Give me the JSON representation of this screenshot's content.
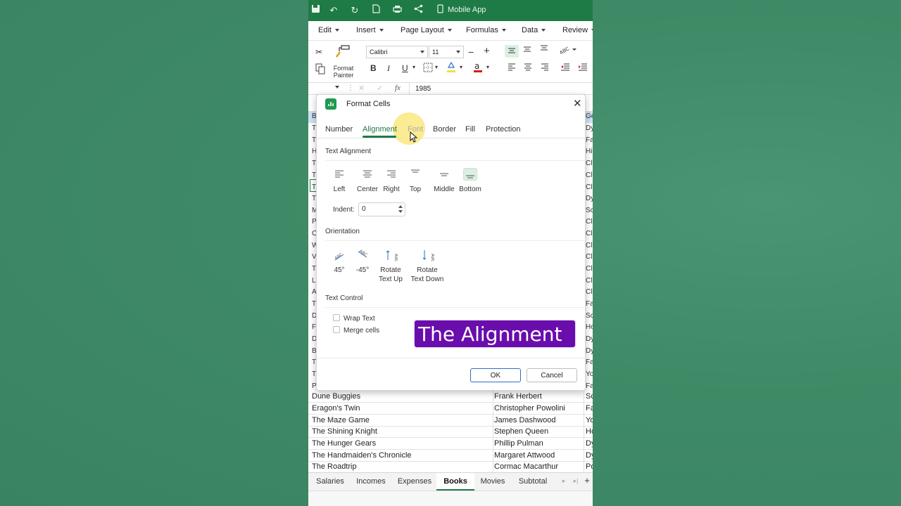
{
  "titlebar": {
    "mobile_app_label": "Mobile App"
  },
  "menu": {
    "items": [
      "Edit",
      "Insert",
      "Page Layout",
      "Formulas",
      "Data",
      "Review"
    ]
  },
  "ribbon": {
    "format_painter_line1": "Format",
    "format_painter_line2": "Painter",
    "font_name": "Calibri",
    "font_size": "11",
    "font_minus": "−",
    "font_plus": "+"
  },
  "formula_bar": {
    "fx": "fx",
    "value": "1985"
  },
  "sheet": {
    "left_edge": [
      "B",
      "T",
      "T",
      "H",
      "T",
      "T",
      "T",
      "",
      "T",
      "M",
      "P",
      "C",
      "W",
      "V",
      "T",
      "L",
      "A",
      "T",
      "D",
      "F",
      "D",
      "B",
      "T",
      "T",
      "P",
      "T"
    ],
    "right_edge": [
      "Ge",
      "Dy",
      "Fa",
      "Hi",
      "Cl",
      "Cl",
      "Cl",
      "Dy",
      "Sc",
      "Cl",
      "Cl",
      "Cl",
      "Cl",
      "Cl",
      "Cl",
      "Cl",
      "Fa",
      "Sc",
      "Ho",
      "Dy",
      "Dy",
      "Fa",
      "Yo",
      "Fa",
      "Ro"
    ],
    "rows": [
      {
        "title": "Dune Buggies",
        "author": "Frank Herbert",
        "genre": "Sc"
      },
      {
        "title": "Eragon's Twin",
        "author": "Christopher Powolini",
        "genre": "Fa"
      },
      {
        "title": "The Maze Game",
        "author": "James Dashwood",
        "genre": "Yo"
      },
      {
        "title": "The Shining Knight",
        "author": "Stephen Queen",
        "genre": "Ho"
      },
      {
        "title": "The Hunger Gears",
        "author": "Phillip Pulman",
        "genre": "Dy"
      },
      {
        "title": "The Handmaiden's Chronicle",
        "author": "Margaret Attwood",
        "genre": "Dy"
      },
      {
        "title": "The Roadtrip",
        "author": "Cormac Macarthur",
        "genre": "Po"
      }
    ]
  },
  "sheet_tabs": [
    "Salaries",
    "Incomes",
    "Expenses",
    "Books",
    "Movies",
    "Subtotal"
  ],
  "dialog": {
    "title": "Format Cells",
    "tabs": [
      "Number",
      "Alignment",
      "Font",
      "Border",
      "Fill",
      "Protection"
    ],
    "text_alignment_title": "Text Alignment",
    "align_options": [
      "Left",
      "Center",
      "Right",
      "Top",
      "Middle",
      "Bottom"
    ],
    "indent_label": "Indent:",
    "indent_value": "0",
    "orientation_title": "Orientation",
    "orientation": {
      "deg45": "45°",
      "degm45": "-45°",
      "rot_up_1": "Rotate",
      "rot_up_2": "Text Up",
      "rot_down_1": "Rotate",
      "rot_down_2": "Text Down"
    },
    "text_control_title": "Text Control",
    "wrap_text": "Wrap Text",
    "merge_cells": "Merge cells",
    "ok": "OK",
    "cancel": "Cancel"
  },
  "overlay": {
    "caption": "The Alignment"
  },
  "colors": {
    "brand_green": "#1e7b45",
    "caption_purple": "#6a0dad",
    "highlight": "#fae46e"
  }
}
